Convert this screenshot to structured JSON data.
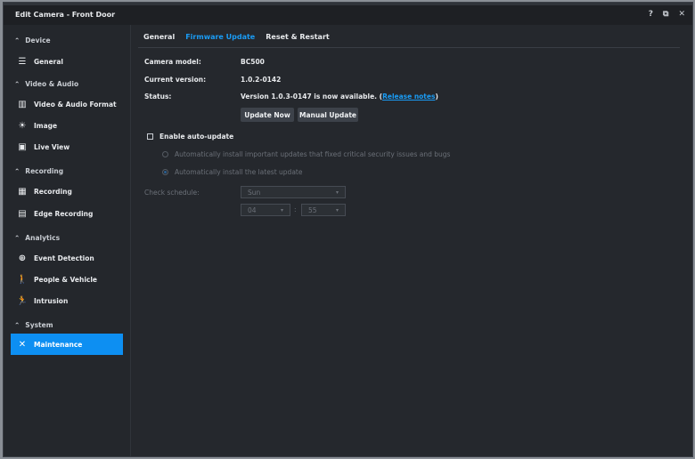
{
  "window": {
    "title": "Edit Camera - Front Door",
    "controls": [
      "?",
      "⧉",
      "✕"
    ]
  },
  "sidebar": {
    "sections": [
      {
        "label": "Device",
        "items": [
          {
            "label": "General",
            "icon": "list-icon"
          }
        ]
      },
      {
        "label": "Video & Audio",
        "items": [
          {
            "label": "Video & Audio Format",
            "icon": "film-icon"
          },
          {
            "label": "Image",
            "icon": "brightness-icon"
          },
          {
            "label": "Live View",
            "icon": "play-box-icon"
          }
        ]
      },
      {
        "label": "Recording",
        "items": [
          {
            "label": "Recording",
            "icon": "calendar-record-icon"
          },
          {
            "label": "Edge Recording",
            "icon": "sd-card-icon"
          }
        ]
      },
      {
        "label": "Analytics",
        "items": [
          {
            "label": "Event Detection",
            "icon": "crosshair-icon"
          },
          {
            "label": "People & Vehicle",
            "icon": "person-vehicle-icon"
          },
          {
            "label": "Intrusion",
            "icon": "running-person-icon"
          }
        ]
      },
      {
        "label": "System",
        "items": [
          {
            "label": "Maintenance",
            "icon": "tools-icon",
            "active": true
          }
        ]
      }
    ]
  },
  "tabs": [
    {
      "label": "General"
    },
    {
      "label": "Firmware Update",
      "active": true
    },
    {
      "label": "Reset & Restart"
    }
  ],
  "firmware": {
    "model_label": "Camera model:",
    "model": "BC500",
    "current_label": "Current version:",
    "current": "1.0.2-0142",
    "status_label": "Status:",
    "status_text": "Version 1.0.3-0147 is now available. (",
    "release_notes": "Release notes",
    "status_close": ")",
    "update_now": "Update Now",
    "manual_update": "Manual Update",
    "auto_update_label": "Enable auto-update",
    "option_critical": "Automatically install important updates that fixed critical security issues and bugs",
    "option_latest": "Automatically install the latest update",
    "schedule_label": "Check schedule:",
    "day": "Sun",
    "hour": "04",
    "minute": "55",
    "time_sep": ":"
  },
  "colors": {
    "accent": "#0d8ff2",
    "background": "#25282d",
    "sidebar": "#24272c"
  }
}
